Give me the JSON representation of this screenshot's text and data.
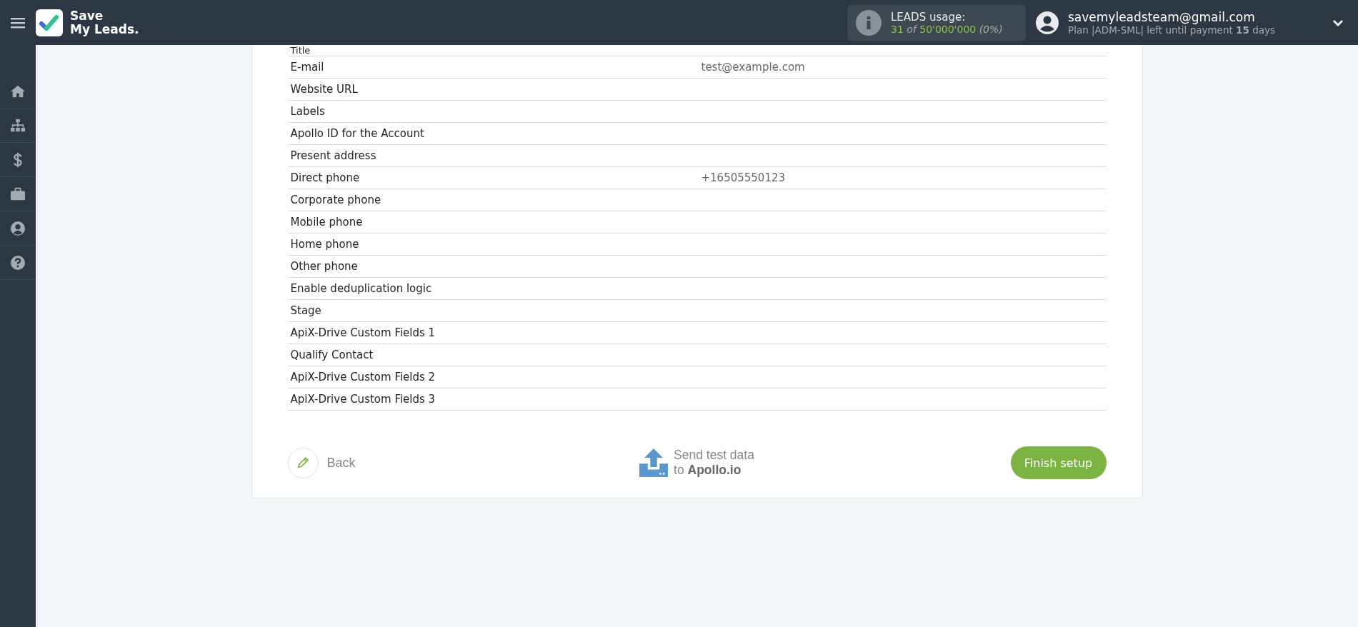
{
  "header": {
    "logo_lines": [
      "Save",
      "My Leads."
    ],
    "usage": {
      "label": "LEADS usage:",
      "used": "31",
      "of": "of",
      "total": "50'000'000",
      "percent": "(0%)"
    },
    "account": {
      "email": "savemyleadsteam@gmail.com",
      "plan": "Plan |ADM-SML| left until payment **15** days"
    }
  },
  "fields": [
    {
      "label": "Title"
    },
    {
      "label": "E-mail",
      "value": "test@example.com"
    },
    {
      "label": "Website URL"
    },
    {
      "label": "Labels"
    },
    {
      "label": "Apollo ID for the Account"
    },
    {
      "label": "Present address"
    },
    {
      "label": "Direct phone",
      "value": "+16505550123"
    },
    {
      "label": "Corporate phone"
    },
    {
      "label": "Mobile phone"
    },
    {
      "label": "Home phone"
    },
    {
      "label": "Other phone"
    },
    {
      "label": "Enable deduplication logic"
    },
    {
      "label": "Stage"
    },
    {
      "label": "ApiX-Drive Custom Fields 1"
    },
    {
      "label": "Qualify Contact"
    },
    {
      "label": "ApiX-Drive Custom Fields 2"
    },
    {
      "label": "ApiX-Drive Custom Fields 3"
    }
  ],
  "footer": {
    "back": "Back",
    "send_lines": [
      "Send test data",
      "to **Apollo.io**"
    ],
    "finish": "Finish setup"
  }
}
